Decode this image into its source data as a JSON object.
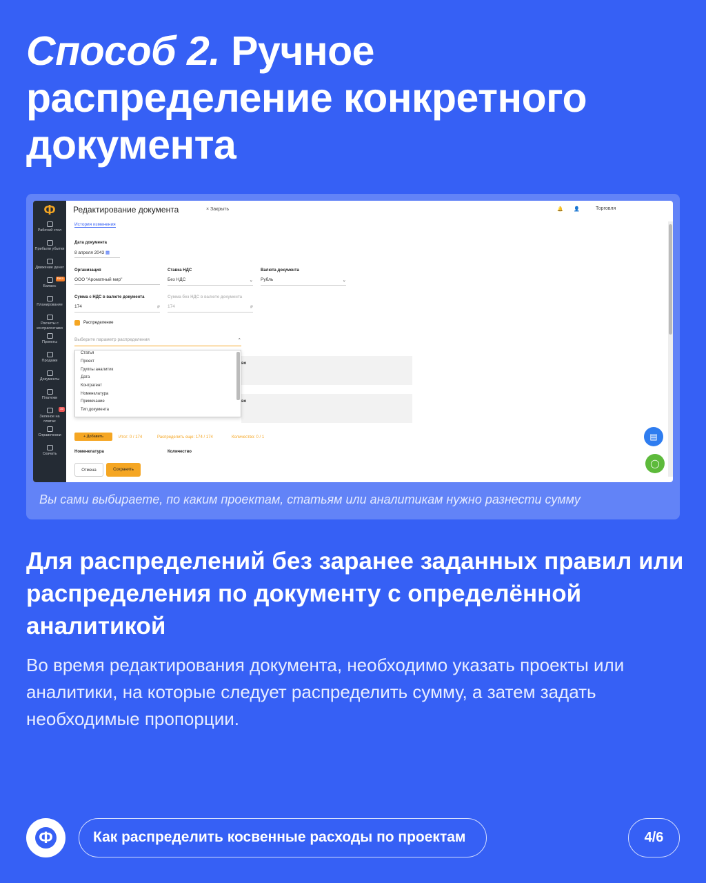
{
  "slide": {
    "title_em": "Способ 2.",
    "title_rest": " Ручное распределение конкретного документа",
    "caption": "Вы сами выбираете, по каким проектам, статьям или аналитикам нужно разнести сумму",
    "subtitle": "Для распределений без заранее заданных правил или распределения по документу с определённой аналитикой",
    "body": "Во время редактирования документа, необходимо указать проекты или аналитики, на которые следует распределить сумму, а затем задать необходимые пропорции.",
    "footer_logo": "Ф",
    "footer_title": "Как распределить косвенные расходы по проектам",
    "page": "4/6"
  },
  "app": {
    "logo": "Ф",
    "nav": [
      {
        "label": "Рабочий стол",
        "icon": "desktop-icon",
        "badge": ""
      },
      {
        "label": "Прибыли убытки",
        "icon": "chart-icon",
        "badge": ""
      },
      {
        "label": "Движение денег",
        "icon": "money-icon",
        "badge": ""
      },
      {
        "label": "Баланс",
        "icon": "balance-icon",
        "badge": "Beta"
      },
      {
        "label": "Планирование",
        "icon": "planning-icon",
        "badge": ""
      },
      {
        "label": "Расчеты с контрагентами",
        "icon": "contractors-icon",
        "badge": ""
      },
      {
        "label": "Проекты",
        "icon": "projects-icon",
        "badge": ""
      },
      {
        "label": "Продажи",
        "icon": "sales-icon",
        "badge": ""
      },
      {
        "label": "Документы",
        "icon": "documents-icon",
        "badge": ""
      },
      {
        "label": "Платежи",
        "icon": "payments-icon",
        "badge": ""
      },
      {
        "label": "Зеленое на платах",
        "icon": "green-icon",
        "badge": "10"
      },
      {
        "label": "Справочники",
        "icon": "directories-icon",
        "badge": ""
      },
      {
        "label": "Скачать",
        "icon": "download-icon",
        "badge": ""
      }
    ],
    "header_title": "Редактирование документа",
    "close_label": "Закрыть",
    "history_link": "История изменения",
    "company": "Торговля",
    "avatar": "С",
    "date_label": "Дата документа",
    "date_value": "8 апреля 2043",
    "org_label": "Организация",
    "org_value": "ООО \"Ароматный мир\"",
    "vat_label": "Ставка НДС",
    "vat_value": "Без НДС",
    "currency_label": "Валюта документа",
    "currency_value": "Рубль",
    "sum_vat_label": "Сумма с НДС в валюте документа",
    "sum_vat_value": "174",
    "sum_novat_label": "Сумма без НДС в валюте документа",
    "sum_novat_value": "174",
    "currency_sign": "₽",
    "distribution_label": "Распределение",
    "select_placeholder": "Выберите параметр распределения",
    "options": [
      "Статья",
      "Проект",
      "Группы аналитик",
      "Дата",
      "Контрагент",
      "Номенклатура",
      "Примечание",
      "Тип документа"
    ],
    "panel_label": "во",
    "add_label": "+ Добавить",
    "total_text": "Итог: 0 / 174",
    "remaining_text": "Распределить еще: 174 / 174",
    "quantity_text": "Количество: 0 / 1",
    "col_nomenclature": "Номенклатура",
    "col_quantity": "Количество",
    "cancel_label": "Отмена",
    "save_label": "Сохранить"
  }
}
